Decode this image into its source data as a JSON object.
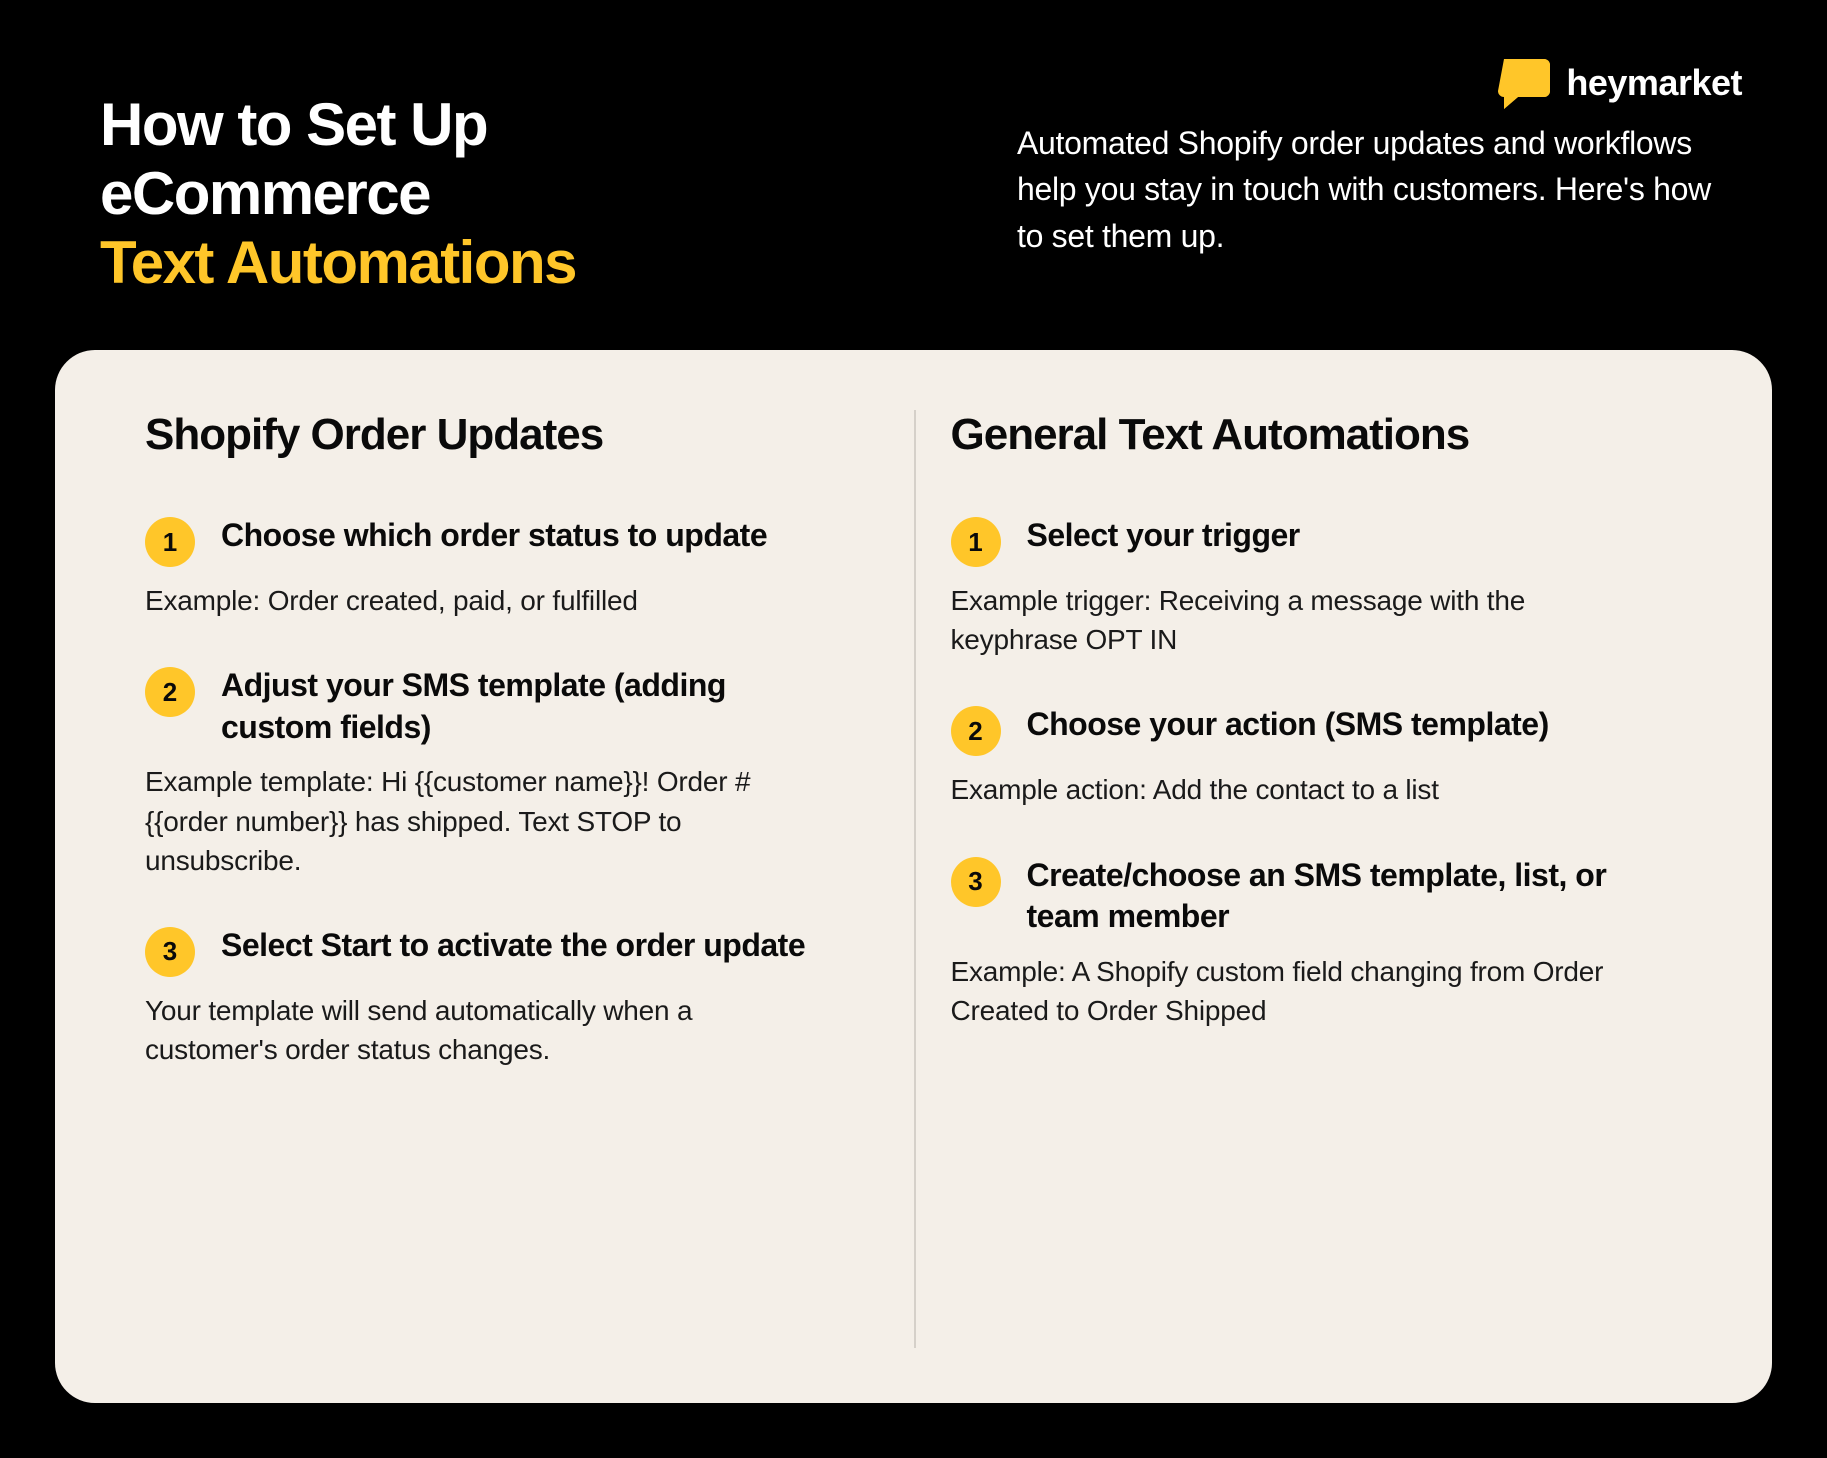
{
  "brand": {
    "name": "heymarket"
  },
  "hero": {
    "title_line1": "How to Set Up",
    "title_line2": "eCommerce",
    "title_accent": "Text Automations",
    "intro": "Automated Shopify order updates and workflows help you stay in touch with customers. Here's how to set them up."
  },
  "card": {
    "left": {
      "heading": "Shopify Order Updates",
      "steps": [
        {
          "num": "1",
          "title": "Choose which order status to update",
          "body_label": "Example:",
          "body_text": " Order created, paid, or fulfilled"
        },
        {
          "num": "2",
          "title": "Adjust your SMS template (adding custom fields)",
          "body_label": "Example template:",
          "body_text": " Hi {{customer name}}! Order #{{order number}} has shipped. Text STOP to unsubscribe."
        },
        {
          "num": "3",
          "title": "Select Start to activate the order update",
          "body_label": "",
          "body_text": "Your template will send automatically when a customer's order status changes."
        }
      ]
    },
    "right": {
      "heading": "General Text Automations",
      "steps": [
        {
          "num": "1",
          "title": "Select your trigger",
          "body_label": "Example trigger:",
          "body_text": " Receiving a message with the keyphrase OPT IN"
        },
        {
          "num": "2",
          "title": "Choose your action (SMS template)",
          "body_label": "Example action:",
          "body_text": " Add the contact to a list"
        },
        {
          "num": "3",
          "title": "Create/choose an SMS template, list, or team member",
          "body_label": "Example:",
          "body_text": " A Shopify custom field changing from Order Created to Order Shipped"
        }
      ]
    }
  }
}
